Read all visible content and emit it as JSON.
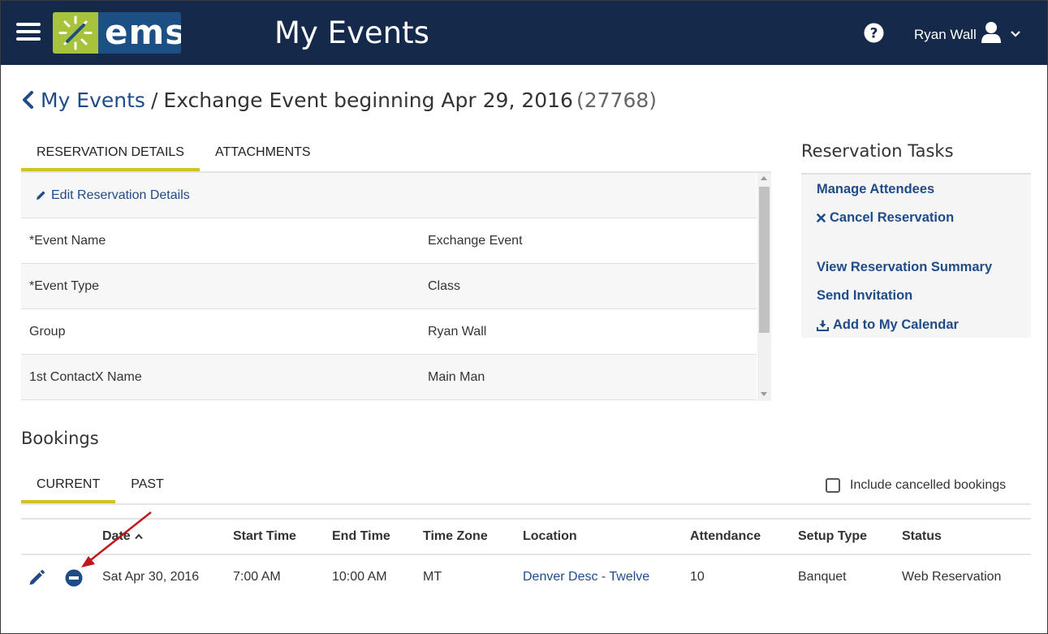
{
  "header": {
    "logo_text": "ems",
    "app_title": "My Events",
    "user_name": "Ryan Wall",
    "colors": {
      "navbar": "#152a4a",
      "logo_blue": "#1c4f84",
      "logo_green": "#a6c33b"
    }
  },
  "breadcrumb": {
    "parent": "My Events",
    "separator": "/",
    "current": "Exchange Event beginning Apr 29, 2016",
    "id": "(27768)"
  },
  "detail_tabs": [
    {
      "label": "RESERVATION DETAILS",
      "active": true
    },
    {
      "label": "ATTACHMENTS",
      "active": false
    }
  ],
  "details": {
    "edit_link": "Edit Reservation Details",
    "rows": [
      {
        "label": "*Event Name",
        "value": "Exchange Event"
      },
      {
        "label": "*Event Type",
        "value": "Class"
      },
      {
        "label": "Group",
        "value": "Ryan Wall"
      },
      {
        "label": "1st ContactX Name",
        "value": "Main Man"
      }
    ]
  },
  "tasks": {
    "title": "Reservation Tasks",
    "items": [
      {
        "label": "Manage Attendees",
        "icon": ""
      },
      {
        "label": "Cancel Reservation",
        "icon": "x-icon"
      },
      {
        "label": "View Reservation Summary",
        "icon": ""
      },
      {
        "label": "Send Invitation",
        "icon": ""
      },
      {
        "label": "Add to My Calendar",
        "icon": "download-icon"
      }
    ]
  },
  "bookings": {
    "title": "Bookings",
    "tabs": [
      {
        "label": "CURRENT",
        "active": true
      },
      {
        "label": "PAST",
        "active": false
      }
    ],
    "include_cancelled_label": "Include cancelled bookings",
    "include_cancelled_checked": false,
    "columns": [
      "Date",
      "Start Time",
      "End Time",
      "Time Zone",
      "Location",
      "Attendance",
      "Setup Type",
      "Status"
    ],
    "sort_column": "Date",
    "sort_direction": "ascending",
    "rows": [
      {
        "date": "Sat Apr 30, 2016",
        "start_time": "7:00 AM",
        "end_time": "10:00 AM",
        "time_zone": "MT",
        "location": "Denver Desc - Twelve",
        "attendance": "10",
        "setup_type": "Banquet",
        "status": "Web Reservation"
      }
    ]
  },
  "colors": {
    "link": "#1f4c88",
    "tab_underline": "#d2c024",
    "annotation_arrow": "#c0161c"
  }
}
